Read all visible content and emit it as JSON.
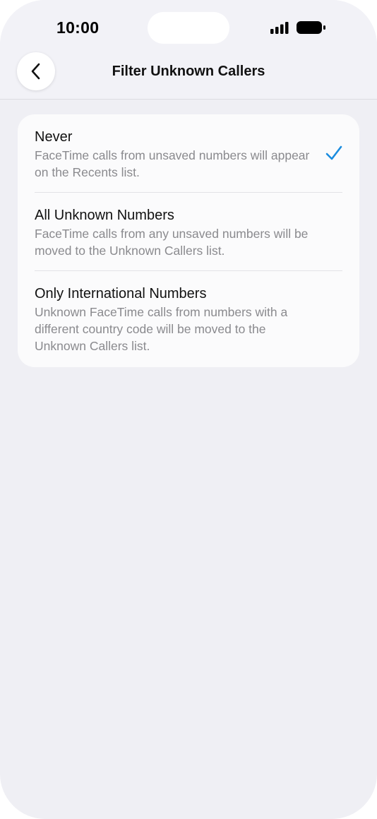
{
  "status_bar": {
    "time": "10:00"
  },
  "nav": {
    "title": "Filter Unknown Callers",
    "back_icon": "chevron-left-icon"
  },
  "options": [
    {
      "title": "Never",
      "description": "FaceTime calls from unsaved numbers will appear on the Recents list.",
      "selected": true
    },
    {
      "title": "All Unknown Numbers",
      "description": "FaceTime calls from any unsaved numbers will be moved to the Unknown Callers list.",
      "selected": false
    },
    {
      "title": "Only International Numbers",
      "description": "Unknown FaceTime calls from numbers with a different country code will be moved to the Unknown Callers list.",
      "selected": false
    }
  ],
  "colors": {
    "accent": "#1a8cdf",
    "background": "#efeff4",
    "card": "#fbfbfc",
    "secondary_text": "#8a8a8e"
  }
}
